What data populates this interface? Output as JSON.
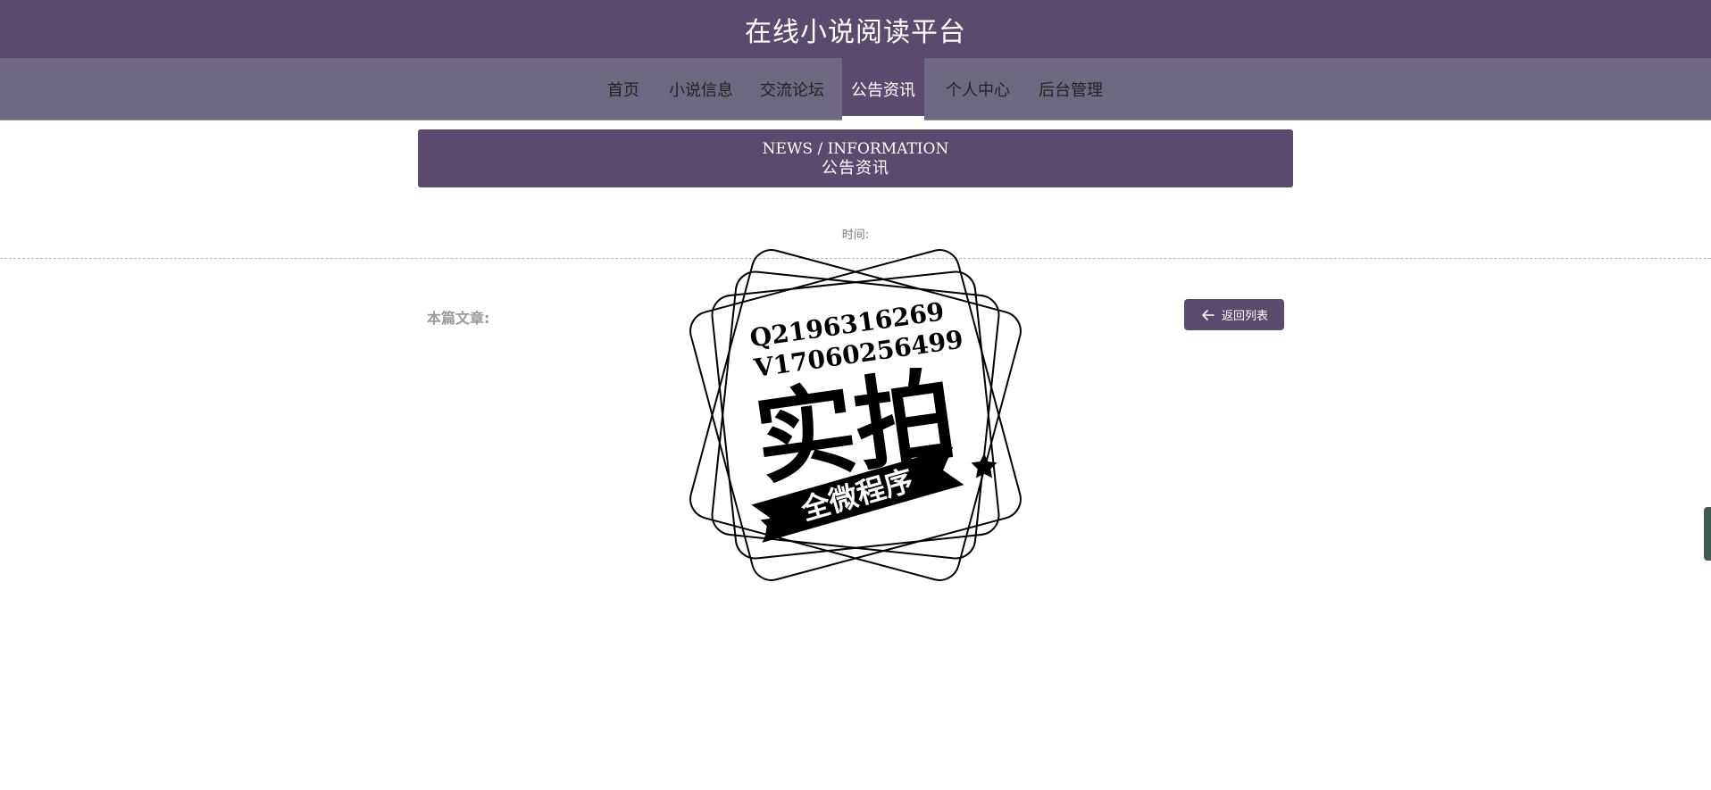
{
  "header": {
    "title": "在线小说阅读平台"
  },
  "nav": {
    "items": [
      {
        "label": "首页"
      },
      {
        "label": "小说信息"
      },
      {
        "label": "交流论坛"
      },
      {
        "label": "公告资讯",
        "active": true
      },
      {
        "label": "个人中心"
      },
      {
        "label": "后台管理"
      }
    ]
  },
  "banner": {
    "title_en": "NEWS / INFORMATION",
    "title_cn": "公告资讯"
  },
  "article": {
    "time_label": "时间:",
    "content_label": "本篇文章:"
  },
  "actions": {
    "back_label": "返回列表"
  },
  "watermark": {
    "line1": "Q2196316269",
    "line2": "V17060256499",
    "big_text": "实拍",
    "ribbon_text": "全微程序"
  },
  "colors": {
    "primary": "#5a4a6e",
    "nav_bg": "#6e6882"
  }
}
